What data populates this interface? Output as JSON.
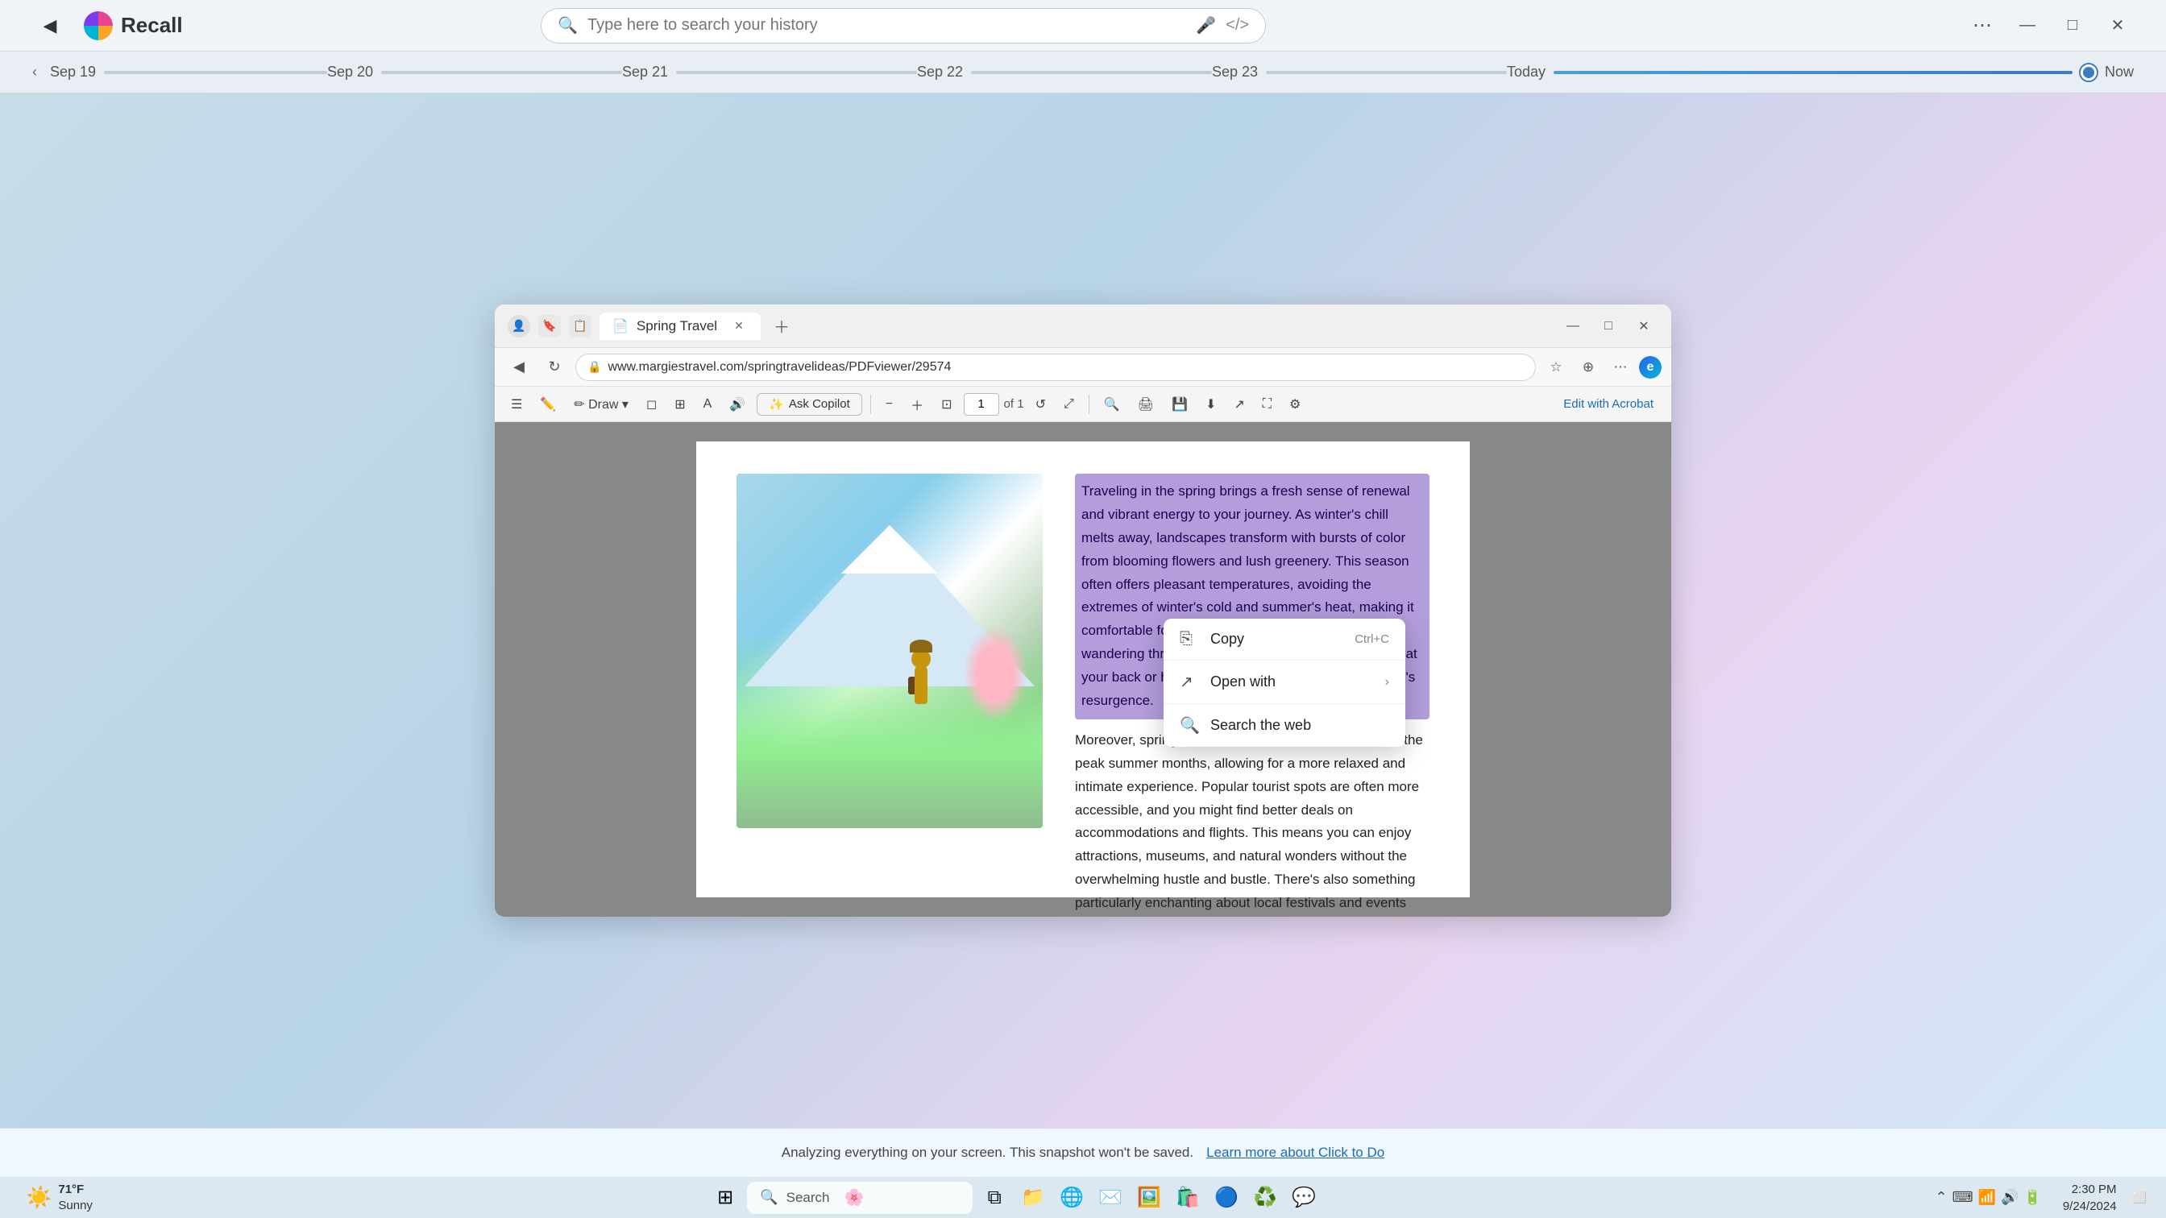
{
  "recall": {
    "app_name": "Recall",
    "back_icon": "◀",
    "search_placeholder": "Type here to search your history",
    "search_icon": "🔍",
    "mic_icon": "🎤",
    "code_icon": "</>",
    "more_icon": "⋯",
    "minimize_icon": "—",
    "maximize_icon": "□",
    "close_icon": "✕"
  },
  "timeline": {
    "items": [
      {
        "label": "Sep 19",
        "active": false
      },
      {
        "label": "Sep 20",
        "active": false
      },
      {
        "label": "Sep 21",
        "active": false
      },
      {
        "label": "Sep 22",
        "active": false
      },
      {
        "label": "Sep 23",
        "active": false
      },
      {
        "label": "Today",
        "active": true
      }
    ],
    "now_label": "Now"
  },
  "browser": {
    "tab_title": "Spring Travel",
    "tab_icon": "📄",
    "url": "www.margiestravel.com/springtravelideas/PDFviewer/29574",
    "win_minimize": "—",
    "win_maximize": "□",
    "win_close": "✕"
  },
  "pdf": {
    "toolbar": {
      "page_number": "1",
      "page_total": "of 1",
      "copilot_label": "Ask Copilot",
      "edit_acrobat_label": "Edit with Acrobat"
    },
    "content": {
      "highlighted_paragraph": "Traveling in the spring brings a fresh sense of renewal and vibrant energy to your journey. As winter's chill melts away, landscapes transform with bursts of color from blooming flowers and lush greenery. This season often offers pleasant temperatures, avoiding the extremes of winter's cold and summer's heat, making it comfortable for exploring new destinations. Imagining wandering through quaint towns with a gentle breeze at your back or hiking scenic trails surrounded by nature's resurgence.",
      "regular_paragraph": "Moreover, spring travel tends to be less crowded than the peak summer months, allowing for a more relaxed and intimate experience. Popular tourist spots are often more accessible, and you might find better deals on accommodations and flights. This means you can enjoy attractions, museums, and natural wonders without the overwhelming hustle and bustle. There's also something particularly enchanting about local festivals and events celebrating the arrival of spring, which provide a deeper connection to the culture and traditions of the place you're visiting."
    }
  },
  "context_menu": {
    "items": [
      {
        "icon": "⎘",
        "label": "Copy",
        "shortcut": "Ctrl+C",
        "arrow": ""
      },
      {
        "icon": "↗",
        "label": "Open with",
        "shortcut": "",
        "arrow": "›"
      },
      {
        "icon": "🔍",
        "label": "Search the web",
        "shortcut": "",
        "arrow": ""
      }
    ]
  },
  "status_bar": {
    "message": "Analyzing everything on your screen. This snapshot won't be saved.",
    "link_text": "Learn more about Click to Do"
  },
  "taskbar": {
    "weather_temp": "71°F",
    "weather_desc": "Sunny",
    "search_label": "Search",
    "clock_time": "2:30 PM",
    "clock_date": "9/24/2024"
  }
}
